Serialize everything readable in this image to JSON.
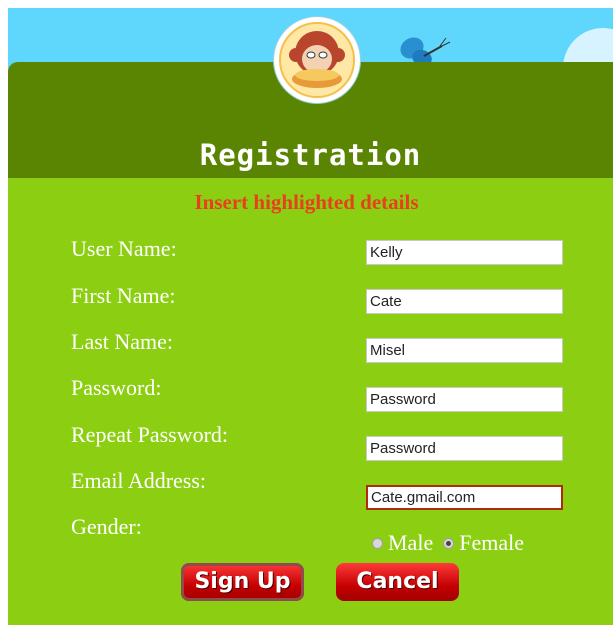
{
  "form": {
    "title": "Registration",
    "subtitle": "Insert highlighted details",
    "fields": [
      {
        "label": "User Name:",
        "value": "Kelly"
      },
      {
        "label": "First Name:",
        "value": "Cate"
      },
      {
        "label": "Last Name:",
        "value": "Misel"
      },
      {
        "label": "Password:",
        "value": "Password"
      },
      {
        "label": "Repeat Password:",
        "value": "Password"
      },
      {
        "label": "Email Address:",
        "value": "Cate.gmail.com"
      }
    ],
    "gender": {
      "label": "Gender:",
      "options": [
        "Male",
        "Female"
      ],
      "selected": "Female"
    },
    "buttons": {
      "signup": "Sign Up",
      "cancel": "Cancel"
    }
  },
  "colors": {
    "sky": "#5fd6fb",
    "panel": "#8ccf12",
    "panel_header": "#5a8502",
    "subtitle": "#e8401c",
    "button_red": "#d00000"
  },
  "icons": {
    "avatar": "monkey-avatar-icon",
    "decoration": "butterfly-icon"
  }
}
